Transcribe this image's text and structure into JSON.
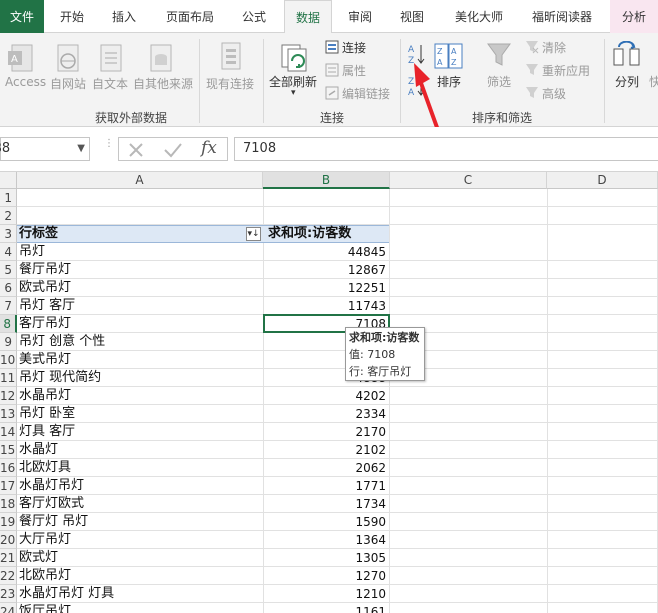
{
  "tabs": [
    {
      "label": "文件",
      "kind": "file"
    },
    {
      "label": "开始"
    },
    {
      "label": "插入"
    },
    {
      "label": "页面布局"
    },
    {
      "label": "公式"
    },
    {
      "label": "数据",
      "active": true
    },
    {
      "label": "审阅"
    },
    {
      "label": "视图"
    },
    {
      "label": "美化大师"
    },
    {
      "label": "福昕阅读器"
    },
    {
      "label": "分析",
      "kind": "tool"
    }
  ],
  "ribbon": {
    "get_external": {
      "label": "获取外部数据",
      "access": "Access",
      "web": "自网站",
      "text": "自文本",
      "other": "自其他来源",
      "existing": "现有连接"
    },
    "connections": {
      "label": "连接",
      "refresh_all": "全部刷新",
      "connections": "连接",
      "properties": "属性",
      "edit_links": "编辑链接"
    },
    "sort_filter": {
      "label": "排序和筛选",
      "sort": "排序",
      "filter": "筛选",
      "clear": "清除",
      "reapply": "重新应用",
      "advanced": "高级"
    },
    "tools": {
      "text_to_columns": "分列",
      "fast_cut": "快"
    }
  },
  "formula_bar": {
    "name_box": "B8",
    "formula": "7108",
    "fx": "fx"
  },
  "columns": [
    "A",
    "B",
    "C",
    "D"
  ],
  "pivot": {
    "row_label_header": "行标签",
    "value_header": "求和项:访客数",
    "rows": [
      {
        "row": "4",
        "label": "吊灯",
        "value": "44845"
      },
      {
        "row": "5",
        "label": "餐厅吊灯",
        "value": "12867"
      },
      {
        "row": "6",
        "label": "欧式吊灯",
        "value": "12251"
      },
      {
        "row": "7",
        "label": "吊灯 客厅",
        "value": "11743"
      },
      {
        "row": "8",
        "label": "客厅吊灯",
        "value": "7108"
      },
      {
        "row": "9",
        "label": "吊灯 创意 个性",
        "value": ""
      },
      {
        "row": "10",
        "label": "美式吊灯",
        "value": ""
      },
      {
        "row": "11",
        "label": "吊灯 现代简约",
        "value": "4888"
      },
      {
        "row": "12",
        "label": "水晶吊灯",
        "value": "4202"
      },
      {
        "row": "13",
        "label": "吊灯 卧室",
        "value": "2334"
      },
      {
        "row": "14",
        "label": "灯具 客厅",
        "value": "2170"
      },
      {
        "row": "15",
        "label": "水晶灯",
        "value": "2102"
      },
      {
        "row": "16",
        "label": "北欧灯具",
        "value": "2062"
      },
      {
        "row": "17",
        "label": "水晶灯吊灯",
        "value": "1771"
      },
      {
        "row": "18",
        "label": "客厅灯欧式",
        "value": "1734"
      },
      {
        "row": "19",
        "label": "餐厅灯 吊灯",
        "value": "1590"
      },
      {
        "row": "20",
        "label": "大厅吊灯",
        "value": "1364"
      },
      {
        "row": "21",
        "label": "欧式灯",
        "value": "1305"
      },
      {
        "row": "22",
        "label": "北欧吊灯",
        "value": "1270"
      },
      {
        "row": "23",
        "label": "水晶灯吊灯 灯具",
        "value": "1210"
      },
      {
        "row": "24",
        "label": "饭厅吊灯",
        "value": "1161"
      }
    ]
  },
  "row_numbers": {
    "r1": "1",
    "r2": "2",
    "r3": "3"
  },
  "tooltip": {
    "title": "求和项:访客数",
    "value_line": "值: 7108",
    "row_line": "行: 客厅吊灯"
  },
  "colors": {
    "excel_green": "#217346",
    "annotation_red": "#e8232a"
  }
}
